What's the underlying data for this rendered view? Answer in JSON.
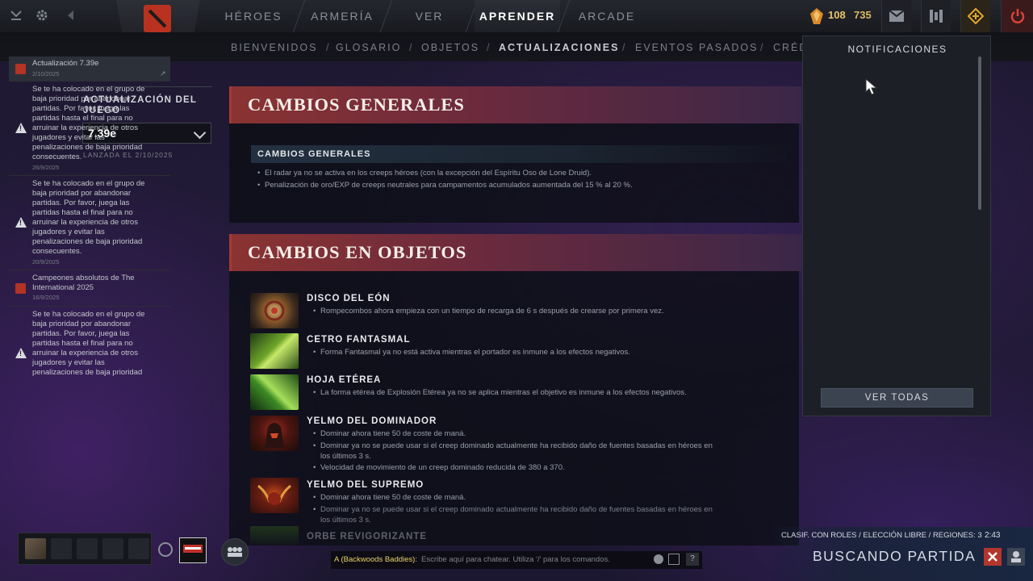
{
  "topbar": {
    "nav": [
      "HÉROES",
      "ARMERÍA",
      "VER",
      "APRENDER",
      "ARCADE"
    ],
    "active_nav": "APRENDER",
    "currency": {
      "shards": "108",
      "gold": "735"
    }
  },
  "subnav": {
    "items": [
      "BIENVENIDOS",
      "GLOSARIO",
      "OBJETOS",
      "ACTUALIZACIONES",
      "EVENTOS PASADOS",
      "CRÉD"
    ],
    "active": "ACTUALIZACIONES"
  },
  "version_panel": {
    "label": "ACTUALIZACIÓN DEL JUEGO",
    "selected": "7.39e",
    "release": "LANZADA EL 2/10/2025"
  },
  "general": {
    "title": "CAMBIOS GENERALES",
    "subheader": "CAMBIOS GENERALES",
    "bullets": [
      "El radar ya no se activa en los creeps héroes (con la excepción del Espíritu Oso de Lone Druid).",
      "Penalización de oro/EXP de creeps neutrales para campamentos acumulados aumentada del 15 % al 20 %."
    ]
  },
  "items_section": {
    "title": "CAMBIOS EN OBJETOS",
    "items": [
      {
        "name": "DISCO DEL EÓN",
        "notes": [
          "Rompecombos ahora empieza con un tiempo de recarga de 6 s después de crearse por primera vez."
        ]
      },
      {
        "name": "CETRO FANTASMAL",
        "notes": [
          "Forma Fantasmal ya no está activa mientras el portador es inmune a los efectos negativos."
        ]
      },
      {
        "name": "HOJA ETÉREA",
        "notes": [
          "La forma etérea de Explosión Etérea ya no se aplica mientras el objetivo es inmune a los efectos negativos."
        ]
      },
      {
        "name": "YELMO DEL DOMINADOR",
        "notes": [
          "Dominar ahora tiene 50 de coste de maná.",
          "Dominar ya no se puede usar si el creep dominado actualmente ha recibido daño de fuentes basadas en héroes en los últimos 3 s.",
          "Velocidad de movimiento de un creep dominado reducida de 380 a 370."
        ]
      },
      {
        "name": "YELMO DEL SUPREMO",
        "notes": [
          "Dominar ahora tiene 50 de coste de maná.",
          "Dominar ya no se puede usar si el creep dominado actualmente ha recibido daño de fuentes basadas en héroes en los últimos 3 s."
        ]
      },
      {
        "name": "ORBE REVIGORIZANTE",
        "notes": []
      }
    ]
  },
  "notifications": {
    "title": "NOTIFICACIONES",
    "entries": [
      {
        "type": "update",
        "text": "Actualización 7.39e",
        "date": "2/10/2025"
      },
      {
        "type": "warning",
        "text": "Se te ha colocado en el grupo de baja prioridad por abandonar partidas. Por favor, juega las partidas hasta el final para no arruinar la experiencia de otros jugadores y evitar las penalizaciones de baja prioridad consecuentes.",
        "date": "26/9/2025"
      },
      {
        "type": "warning",
        "text": "Se te ha colocado en el grupo de baja prioridad por abandonar partidas. Por favor, juega las partidas hasta el final para no arruinar la experiencia de otros jugadores y evitar las penalizaciones de baja prioridad consecuentes.",
        "date": "20/9/2025"
      },
      {
        "type": "news",
        "text": "Campeones absolutos de The International 2025",
        "date": "16/9/2025"
      },
      {
        "type": "warning",
        "text": "Se te ha colocado en el grupo de baja prioridad por abandonar partidas. Por favor, juega las partidas hasta el final para no arruinar la experiencia de otros jugadores y evitar las penalizaciones de baja prioridad",
        "date": ""
      }
    ],
    "view_all": "VER TODAS"
  },
  "chat": {
    "channel": "A (Backwoods Baddies):",
    "placeholder": "Escribe aquí para chatear. Utiliza '/' para los comandos."
  },
  "matchmaking": {
    "info": "CLASIF. CON ROLES / ELECCIÓN LIBRE / REGIONES: 3",
    "timer": "2:43",
    "status": "BUSCANDO PARTIDA"
  },
  "colors": {
    "accent_red": "#b33324",
    "gold": "#e9c46a",
    "header_red": "#8a3332"
  },
  "icons": [
    "back-arrow-icon",
    "settings-gear-icon",
    "dota-logo-icon",
    "shard-icon",
    "mail-icon",
    "armory-icon",
    "plus-icon",
    "power-icon",
    "warning-icon",
    "chevron-down-icon",
    "external-link-icon",
    "headset-icon",
    "party-icon",
    "emoji-icon",
    "help-icon",
    "close-icon",
    "cursor-icon"
  ]
}
